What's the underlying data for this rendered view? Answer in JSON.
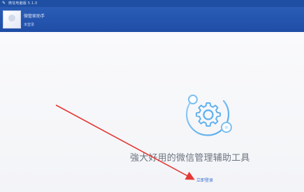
{
  "window": {
    "title": "微信电脑版 5.1.0"
  },
  "header": {
    "account_name": "微管家助手",
    "account_status": "未登录"
  },
  "main": {
    "slogan": "強大好用的微信管理辅助工具",
    "login_link": "立即登录"
  },
  "colors": {
    "titlebar": "#1e4fa3",
    "header": "#2a5db6",
    "accent": "#3a6fd1",
    "logo": "#6fb9f0",
    "annotation_arrow": "#e53935"
  },
  "icons": {
    "logo": "gear-icon",
    "title": "app-icon"
  }
}
